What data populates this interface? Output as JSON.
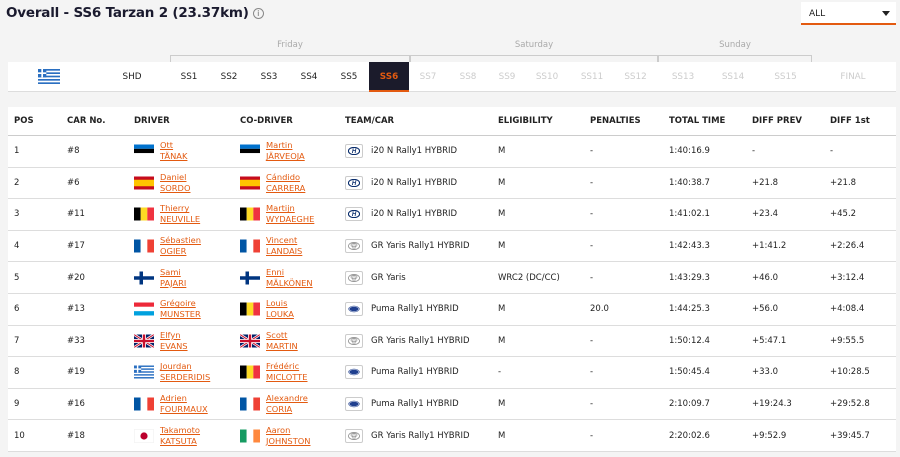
{
  "page": {
    "title": "Overall - SS6 Tarzan 2 (23.37km)",
    "info_glyph": "i"
  },
  "filter": {
    "selected": "ALL"
  },
  "stage_groups": [
    "Friday",
    "Saturday",
    "Sunday"
  ],
  "stages": [
    "SHD",
    "SS1",
    "SS2",
    "SS3",
    "SS4",
    "SS5",
    "SS6",
    "SS7",
    "SS8",
    "SS9",
    "SS10",
    "SS11",
    "SS12",
    "SS13",
    "SS14",
    "SS15",
    "FINAL"
  ],
  "table": {
    "headers": [
      "POS",
      "CAR No.",
      "DRIVER",
      "CO-DRIVER",
      "TEAM/CAR",
      "ELIGIBILITY",
      "PENALTIES",
      "TOTAL TIME",
      "DIFF PREV",
      "DIFF 1st"
    ],
    "rows": [
      {
        "pos": "1",
        "car": "#8",
        "driver1": "Ott",
        "driver2": "TÄNAK",
        "dflag": "est",
        "codriver1": "Martin",
        "codriver2": "JÄRVEOJA",
        "cflag": "est",
        "brand": "hyundai",
        "team": "i20 N Rally1 HYBRID",
        "elig": "M",
        "pen": "-",
        "total": "1:40:16.9",
        "prev": "-",
        "first": "-"
      },
      {
        "pos": "2",
        "car": "#6",
        "driver1": "Daniel",
        "driver2": "SORDO",
        "dflag": "esp",
        "codriver1": "Cándido",
        "codriver2": "CARRERA",
        "cflag": "esp",
        "brand": "hyundai",
        "team": "i20 N Rally1 HYBRID",
        "elig": "M",
        "pen": "-",
        "total": "1:40:38.7",
        "prev": "+21.8",
        "first": "+21.8"
      },
      {
        "pos": "3",
        "car": "#11",
        "driver1": "Thierry",
        "driver2": "NEUVILLE",
        "dflag": "bel",
        "codriver1": "Martijn",
        "codriver2": "WYDAEGHE",
        "cflag": "bel",
        "brand": "hyundai",
        "team": "i20 N Rally1 HYBRID",
        "elig": "M",
        "pen": "-",
        "total": "1:41:02.1",
        "prev": "+23.4",
        "first": "+45.2"
      },
      {
        "pos": "4",
        "car": "#17",
        "driver1": "Sébastien",
        "driver2": "OGIER",
        "dflag": "fra",
        "codriver1": "Vincent",
        "codriver2": "LANDAIS",
        "cflag": "fra",
        "brand": "toyota",
        "team": "GR Yaris Rally1 HYBRID",
        "elig": "M",
        "pen": "-",
        "total": "1:42:43.3",
        "prev": "+1:41.2",
        "first": "+2:26.4"
      },
      {
        "pos": "5",
        "car": "#20",
        "driver1": "Sami",
        "driver2": "PAJARI",
        "dflag": "fin",
        "codriver1": "Enni",
        "codriver2": "MÄLKÖNEN",
        "cflag": "fin",
        "brand": "toyota",
        "team": "GR Yaris",
        "elig": "WRC2 (DC/CC)",
        "pen": "-",
        "total": "1:43:29.3",
        "prev": "+46.0",
        "first": "+3:12.4"
      },
      {
        "pos": "6",
        "car": "#13",
        "driver1": "Grégoire",
        "driver2": "MUNSTER",
        "dflag": "lux",
        "codriver1": "Louis",
        "codriver2": "LOUKA",
        "cflag": "bel",
        "brand": "ford",
        "team": "Puma Rally1 HYBRID",
        "elig": "M",
        "pen": "20.0",
        "total": "1:44:25.3",
        "prev": "+56.0",
        "first": "+4:08.4"
      },
      {
        "pos": "7",
        "car": "#33",
        "driver1": "Elfyn",
        "driver2": "EVANS",
        "dflag": "gbr",
        "codriver1": "Scott",
        "codriver2": "MARTIN",
        "cflag": "gbr",
        "brand": "toyota",
        "team": "GR Yaris Rally1 HYBRID",
        "elig": "M",
        "pen": "-",
        "total": "1:50:12.4",
        "prev": "+5:47.1",
        "first": "+9:55.5"
      },
      {
        "pos": "8",
        "car": "#19",
        "driver1": "Jourdan",
        "driver2": "SERDERIDIS",
        "dflag": "grc",
        "codriver1": "Frédéric",
        "codriver2": "MICLOTTE",
        "cflag": "bel",
        "brand": "ford",
        "team": "Puma Rally1 HYBRID",
        "elig": "-",
        "pen": "-",
        "total": "1:50:45.4",
        "prev": "+33.0",
        "first": "+10:28.5"
      },
      {
        "pos": "9",
        "car": "#16",
        "driver1": "Adrien",
        "driver2": "FOURMAUX",
        "dflag": "fra",
        "codriver1": "Alexandre",
        "codriver2": "CORIA",
        "cflag": "fra",
        "brand": "ford",
        "team": "Puma Rally1 HYBRID",
        "elig": "M",
        "pen": "-",
        "total": "2:10:09.7",
        "prev": "+19:24.3",
        "first": "+29:52.8"
      },
      {
        "pos": "10",
        "car": "#18",
        "driver1": "Takamoto",
        "driver2": "KATSUTA",
        "dflag": "jpn",
        "codriver1": "Aaron",
        "codriver2": "JOHNSTON",
        "cflag": "irl",
        "brand": "toyota",
        "team": "GR Yaris Rally1 HYBRID",
        "elig": "M",
        "pen": "-",
        "total": "2:20:02.6",
        "prev": "+9:52.9",
        "first": "+39:45.7"
      }
    ]
  },
  "colors": {
    "accent": "#e35a10",
    "active_tab_bg": "#1b1b2b"
  }
}
